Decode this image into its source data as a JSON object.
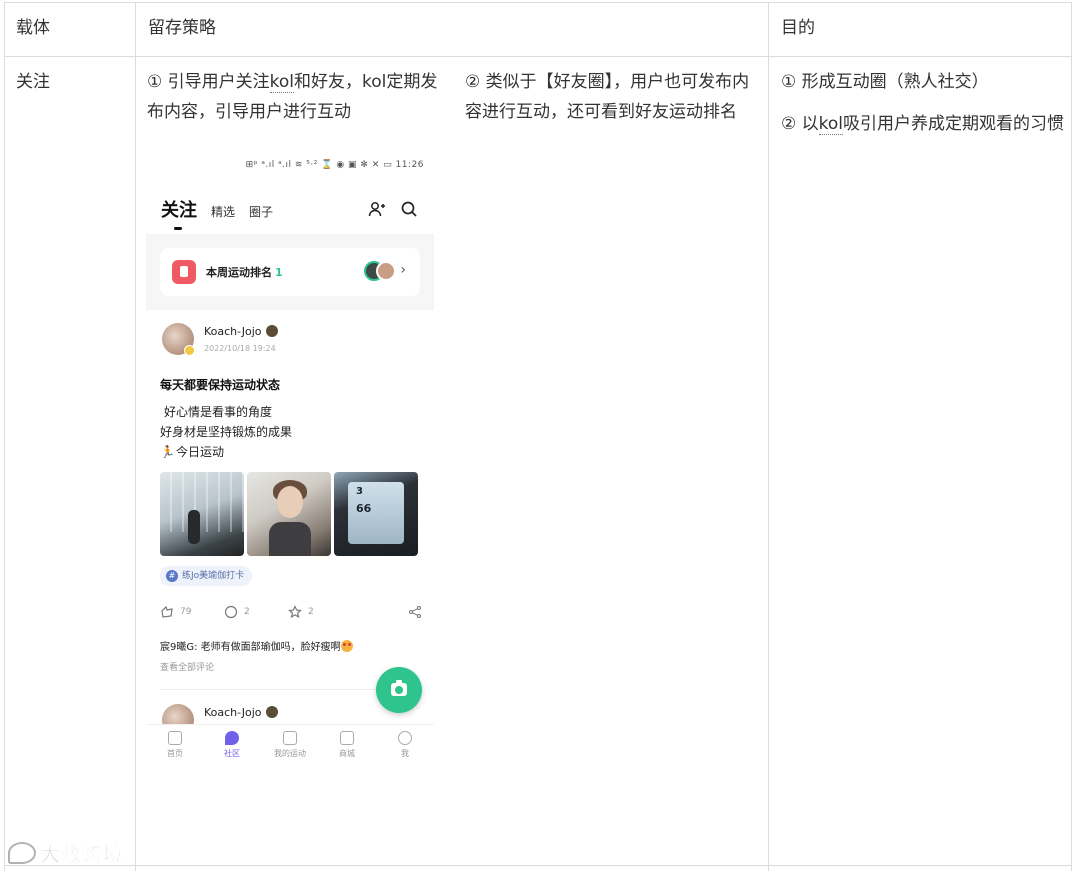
{
  "table": {
    "headers": [
      "载体",
      "留存策略",
      "目的"
    ],
    "row": {
      "carrier": "关注",
      "strategy_1_pre": "① 引导用户关注",
      "strategy_1_kol": "kol",
      "strategy_1_post": "和好友，kol定期发布内容，引导用户进行互动",
      "strategy_2": "② 类似于【好友圈】，用户也可发布内容进行互动，还可看到好友运动排名",
      "purpose_1": "① 形成互动圈（熟人社交）",
      "purpose_2_pre": "② 以",
      "purpose_2_kol": "kol",
      "purpose_2_post": "吸引用户养成定期观看的习惯"
    }
  },
  "phone": {
    "status_bar": "⊞ᵖ ᵃ.ıl ᵃ.ıl ≋ ⁵·² ⌛  ◉ ▣ ✻ ✕ ▭ 11:26",
    "tabs": {
      "active": "关注",
      "t2": "精选",
      "t3": "圈子"
    },
    "icons": {
      "add_friend": "add-user-icon",
      "search": "search-icon"
    },
    "rank": {
      "label": "本周运动排名",
      "value": "1",
      "arrow": "›"
    },
    "post": {
      "author": "Koach-Jojo",
      "date": "2022/10/18 19:24",
      "title": "每天都要保持运动状态",
      "lines": [
        "好心情是看事的角度",
        "好身材是坚持锻炼的成果",
        "今日运动"
      ],
      "tag": "练Jo美瑜伽打卡",
      "likes": "79",
      "comments": "2",
      "stars": "2",
      "comment_author": "宸9曦G:",
      "comment_text": " 老师有做面部瑜伽吗，脸好瘦啊",
      "view_all": "查看全部评论",
      "photo_n1": "3",
      "photo_n2": "66"
    },
    "post2_author": "Koach-Jojo",
    "bottom_nav": [
      "首页",
      "社区",
      "我的运动",
      "商城",
      "我"
    ]
  },
  "watermark": "大数跨境",
  "colors": {
    "accent_green": "#2fc48d",
    "nav_active": "#6f61e8",
    "rank_red": "#f05a64",
    "grid": "#dcdcdc"
  }
}
